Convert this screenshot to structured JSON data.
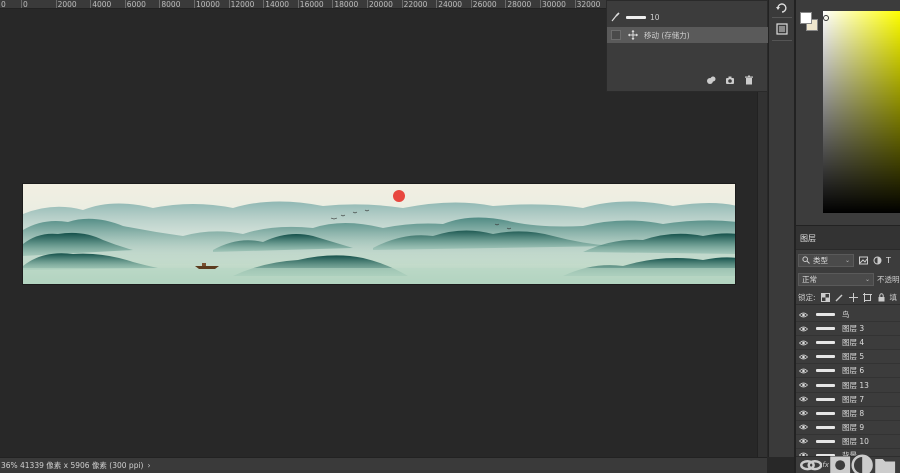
{
  "ruler": {
    "labels": [
      "0",
      "2000",
      "4000",
      "6000",
      "8000",
      "10000",
      "12000",
      "14000",
      "16000",
      "18000",
      "20000",
      "22000",
      "24000",
      "26000",
      "28000",
      "30000",
      "32000"
    ],
    "left_edge_label": "0"
  },
  "history": {
    "rows": [
      {
        "icon": "brush-icon",
        "label": "10"
      },
      {
        "icon": "move-icon",
        "label": "移动 (存储力)"
      }
    ],
    "footer_icons": [
      "new-document-from-state-icon",
      "camera-icon",
      "trash-icon"
    ]
  },
  "status": {
    "zoom": "36%",
    "document_info": "41339 像素 x 5906 像素 (300 ppi)",
    "arrow": "›"
  },
  "color_panel": {
    "foreground": "#ffffff",
    "background": "#efe6cc",
    "hue": "#ffff00"
  },
  "layers": {
    "tab_label": "图层",
    "filter_label": "类型",
    "filter_extra": "T",
    "blend_mode": "正常",
    "opacity_label": "不透明",
    "lock_label": "锁定:",
    "fill_label": "填",
    "items": [
      {
        "name": "鸟"
      },
      {
        "name": "图层 3"
      },
      {
        "name": "图层 4"
      },
      {
        "name": "图层 5"
      },
      {
        "name": "图层 6"
      },
      {
        "name": "图层 13"
      },
      {
        "name": "图层 7"
      },
      {
        "name": "图层 8"
      },
      {
        "name": "图层 9"
      },
      {
        "name": "图层 10"
      },
      {
        "name": "背景"
      }
    ],
    "footer_icons": [
      "link-icon",
      "fx-icon",
      "mask-icon",
      "adjustment-icon",
      "folder-icon"
    ],
    "fx_label": "fx"
  },
  "colors": {
    "ui_background": "#282828",
    "panel": "#3c3c3c",
    "selected_row": "#5a5a5a",
    "sun": "#e8473f",
    "paper": "#eeecdf",
    "mountain_dark": "#1c5a55",
    "mountain_mid": "#5e958e",
    "mist": "#a8cdbd"
  }
}
